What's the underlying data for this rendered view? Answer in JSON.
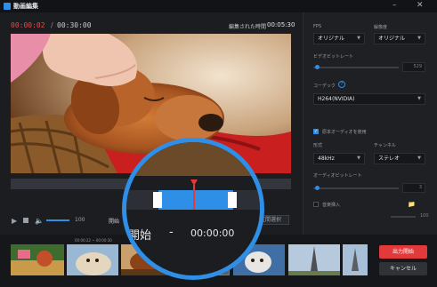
{
  "app": {
    "title": "動画編集"
  },
  "player": {
    "current_time": "00:00:02",
    "separator": "/",
    "total_time": "00:30:00",
    "edited_label": "編集された時間",
    "edited_time": "00:05:30",
    "volume_value": "100",
    "start_label": "開始",
    "segment_button": "区間選択"
  },
  "magnifier": {
    "start_label": "開始",
    "dash": "-",
    "time": "00:00:00"
  },
  "settings": {
    "fps_label": "FPS",
    "fps_value": "オリジナル",
    "resolution_label": "解像度",
    "resolution_value": "オリジナル",
    "video_bitrate_label": "ビデオビットレート",
    "video_bitrate_value": "529",
    "codec_label": "コーデック",
    "codec_value": "H264(NVIDIA)",
    "keep_audio_label": "原本オーディオを使用",
    "format_label": "形式",
    "format_value": "48kHz",
    "channel_label": "チャンネル",
    "channel_value": "ステレオ",
    "audio_bitrate_label": "オーディオビットレート",
    "audio_bitrate_value": "3",
    "insert_audio_label": "音楽挿入",
    "music_volume_value": "100"
  },
  "filmstrip": {
    "range": "00:00:22 ~ 00:00:30"
  },
  "actions": {
    "export_label": "出力開始",
    "cancel_label": "キャンセル"
  },
  "colors": {
    "accent": "#2f8ee6",
    "current_time": "#e24b4b",
    "export_button": "#e23a3a"
  }
}
